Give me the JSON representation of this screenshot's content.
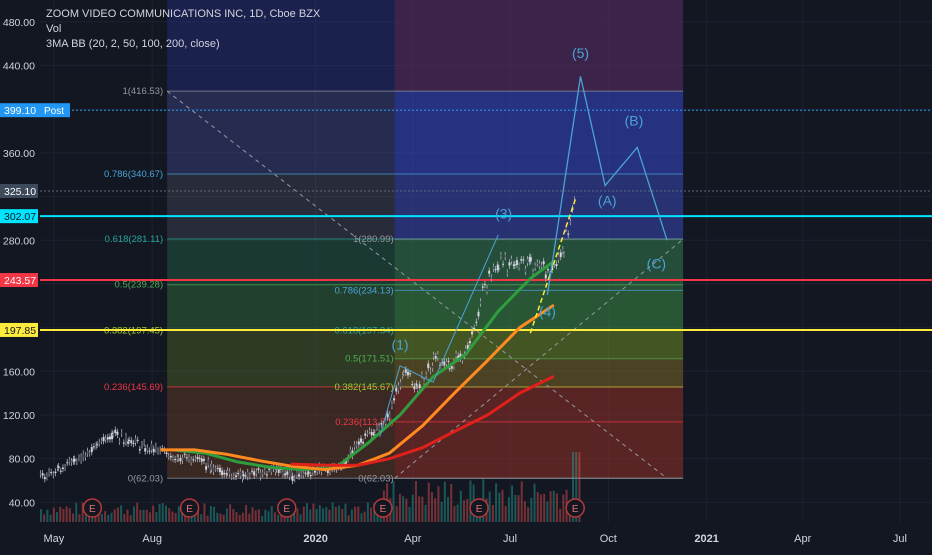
{
  "header": {
    "symbol_line": "ZOOM VIDEO COMMUNICATIONS INC, 1D, Cboe BZX",
    "vol_label": "Vol",
    "indicator_label": "3MA BB (20, 2, 50, 100, 200, close)"
  },
  "colors": {
    "background": "#131722",
    "grid": "#1e2230",
    "axis_text": "#d1d4dc",
    "cyan_line": "#00e5ff",
    "red_line": "#f23645",
    "yellow_line": "#ffeb3b",
    "post_label": "#2196f3",
    "ma_green": "#2e9e3f",
    "ma_orange": "#ff8a1f",
    "ma_red": "#e0201b",
    "wave_text": "#4aa3d8"
  },
  "chart_data": {
    "type": "candlestick",
    "title": "ZOOM VIDEO COMMUNICATIONS INC, 1D, Cboe BZX",
    "y_axis": {
      "ticks": [
        40,
        80,
        120,
        160,
        200,
        240,
        280,
        320,
        360,
        400,
        440,
        480
      ],
      "tick_labels": [
        "40.00",
        "80.00",
        "120.00",
        "160.00",
        "",
        "",
        "280.00",
        "",
        "360.00",
        "",
        "440.00",
        "480.00"
      ],
      "range": [
        22,
        500
      ]
    },
    "x_axis": {
      "ticks": [
        "May",
        "Aug",
        "2020",
        "Apr",
        "Jul",
        "Oct",
        "2021",
        "Apr",
        "Jul"
      ],
      "tick_dates": [
        "2019-05-01",
        "2019-08-01",
        "2020-01-01",
        "2020-04-01",
        "2020-07-01",
        "2020-10-01",
        "2021-01-01",
        "2021-04-01",
        "2021-07-01"
      ],
      "range": [
        "2019-04-18",
        "2021-07-31"
      ]
    },
    "price_labels": [
      {
        "text": "399.10",
        "tag": "Post",
        "value": 399.1,
        "color": "#2196f3"
      },
      {
        "text": "325.10",
        "value": 325.1,
        "color": "#3c4a5c"
      },
      {
        "text": "302.07",
        "value": 302.07,
        "color": "#00e5ff"
      },
      {
        "text": "243.57",
        "value": 243.57,
        "color": "#f23645"
      },
      {
        "text": "197.85",
        "value": 197.85,
        "color": "#ffeb3b"
      }
    ],
    "horizontal_lines": [
      {
        "value": 302.07,
        "color": "#00e5ff"
      },
      {
        "value": 243.57,
        "color": "#f23645"
      },
      {
        "value": 197.85,
        "color": "#ffeb3b"
      }
    ],
    "fib_large": {
      "start": "2019-08-15",
      "end": "2020-12-10",
      "levels": [
        {
          "label": "1(416.53)",
          "value": 416.53
        },
        {
          "label": "0.786(340.67)",
          "value": 340.67
        },
        {
          "label": "0.618(281.11)",
          "value": 281.11
        },
        {
          "label": "0.5(239.28)",
          "value": 239.28
        },
        {
          "label": "0.382(197.45)",
          "value": 197.45
        },
        {
          "label": "0.236(145.69)",
          "value": 145.69
        },
        {
          "label": "0(62.03)",
          "value": 62.03
        }
      ]
    },
    "fib_small": {
      "start": "2020-03-15",
      "end": "2020-12-10",
      "levels": [
        {
          "label": "1(280.99)",
          "value": 280.99
        },
        {
          "label": "0.786(234.13)",
          "value": 234.13
        },
        {
          "label": "0.618(197.34)",
          "value": 197.34
        },
        {
          "label": "0.5(171.51)",
          "value": 171.51
        },
        {
          "label": "0.382(145.67)",
          "value": 145.67
        },
        {
          "label": "0.236(113.70)",
          "value": 113.7
        },
        {
          "label": "0(62.03)",
          "value": 62.03
        }
      ]
    },
    "wave_labels": [
      {
        "text": "(1)",
        "date": "2020-03-20",
        "value": 180
      },
      {
        "text": "(3)",
        "date": "2020-06-25",
        "value": 300
      },
      {
        "text": "(4)",
        "date": "2020-08-05",
        "value": 210
      },
      {
        "text": "(5)",
        "date": "2020-09-05",
        "value": 447
      },
      {
        "text": "(A)",
        "date": "2020-09-30",
        "value": 312
      },
      {
        "text": "(B)",
        "date": "2020-10-25",
        "value": 385
      },
      {
        "text": "(C)",
        "date": "2020-11-15",
        "value": 254
      }
    ],
    "wave_path": [
      {
        "date": "2020-08-05",
        "value": 230
      },
      {
        "date": "2020-09-05",
        "value": 430
      },
      {
        "date": "2020-09-28",
        "value": 330
      },
      {
        "date": "2020-10-28",
        "value": 365
      },
      {
        "date": "2020-11-25",
        "value": 280
      }
    ],
    "earnings_dates": [
      "2019-06-06",
      "2019-09-05",
      "2019-12-05",
      "2020-03-04",
      "2020-06-02",
      "2020-08-31"
    ],
    "series": [
      {
        "name": "MA20",
        "color": "#2e9e3f",
        "points": [
          [
            "2019-08-20",
            88
          ],
          [
            "2019-09-20",
            85
          ],
          [
            "2019-10-20",
            77
          ],
          [
            "2019-11-20",
            72
          ],
          [
            "2019-12-20",
            70
          ],
          [
            "2020-01-20",
            72
          ],
          [
            "2020-02-20",
            95
          ],
          [
            "2020-03-20",
            120
          ],
          [
            "2020-04-20",
            155
          ],
          [
            "2020-05-20",
            175
          ],
          [
            "2020-06-20",
            215
          ],
          [
            "2020-07-20",
            245
          ],
          [
            "2020-08-10",
            260
          ]
        ]
      },
      {
        "name": "MA50",
        "color": "#ff8a1f",
        "points": [
          [
            "2019-08-10",
            88
          ],
          [
            "2019-09-10",
            88
          ],
          [
            "2019-10-10",
            84
          ],
          [
            "2019-11-10",
            78
          ],
          [
            "2019-12-10",
            73
          ],
          [
            "2020-01-10",
            70
          ],
          [
            "2020-02-10",
            74
          ],
          [
            "2020-03-10",
            85
          ],
          [
            "2020-04-10",
            110
          ],
          [
            "2020-05-10",
            140
          ],
          [
            "2020-06-10",
            170
          ],
          [
            "2020-07-10",
            200
          ],
          [
            "2020-08-10",
            220
          ]
        ]
      },
      {
        "name": "MA100",
        "color": "#e0201b",
        "points": [
          [
            "2019-12-10",
            75
          ],
          [
            "2020-01-10",
            74
          ],
          [
            "2020-02-10",
            74
          ],
          [
            "2020-03-10",
            80
          ],
          [
            "2020-04-10",
            90
          ],
          [
            "2020-05-10",
            105
          ],
          [
            "2020-06-10",
            120
          ],
          [
            "2020-07-10",
            140
          ],
          [
            "2020-08-10",
            155
          ]
        ]
      }
    ],
    "price_path": [
      [
        "2019-04-18",
        62
      ],
      [
        "2019-05-05",
        72
      ],
      [
        "2019-05-20",
        78
      ],
      [
        "2019-06-10",
        92
      ],
      [
        "2019-06-25",
        103
      ],
      [
        "2019-07-10",
        98
      ],
      [
        "2019-07-25",
        90
      ],
      [
        "2019-08-10",
        86
      ],
      [
        "2019-08-25",
        82
      ],
      [
        "2019-09-10",
        80
      ],
      [
        "2019-09-25",
        72
      ],
      [
        "2019-10-10",
        67
      ],
      [
        "2019-10-25",
        65
      ],
      [
        "2019-11-10",
        67
      ],
      [
        "2019-11-25",
        70
      ],
      [
        "2019-12-10",
        64
      ],
      [
        "2019-12-25",
        68
      ],
      [
        "2020-01-10",
        70
      ],
      [
        "2020-01-25",
        73
      ],
      [
        "2020-02-10",
        95
      ],
      [
        "2020-02-25",
        105
      ],
      [
        "2020-03-10",
        120
      ],
      [
        "2020-03-23",
        160
      ],
      [
        "2020-04-05",
        145
      ],
      [
        "2020-04-20",
        170
      ],
      [
        "2020-05-05",
        165
      ],
      [
        "2020-05-20",
        178
      ],
      [
        "2020-06-05",
        230
      ],
      [
        "2020-06-20",
        262
      ],
      [
        "2020-07-05",
        255
      ],
      [
        "2020-07-20",
        260
      ],
      [
        "2020-08-05",
        250
      ],
      [
        "2020-08-20",
        275
      ],
      [
        "2020-08-31",
        320
      ]
    ],
    "volume": {
      "unit": "relative",
      "peak_date": "2020-08-31"
    },
    "grid": true
  }
}
